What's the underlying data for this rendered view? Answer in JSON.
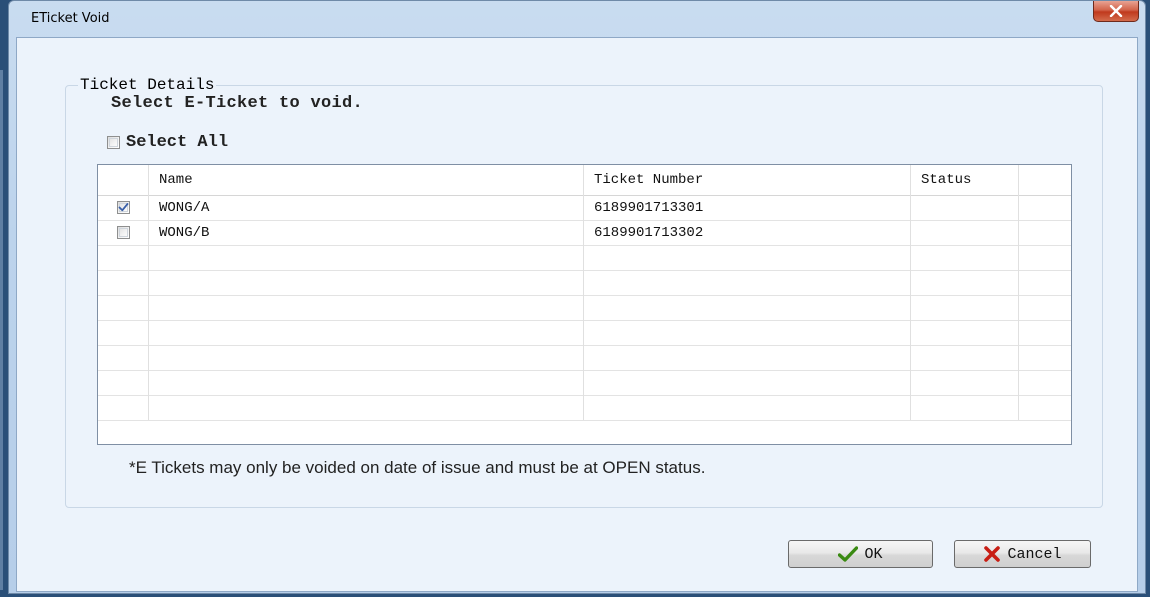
{
  "window": {
    "title": "ETicket Void",
    "close_icon": "close-x-icon"
  },
  "group": {
    "legend": "Ticket Details",
    "instruction": "Select E-Ticket to void.",
    "select_all_label": "Select All",
    "select_all_checked": false
  },
  "table": {
    "columns": [
      "",
      "Name",
      "Ticket Number",
      "Status",
      ""
    ],
    "rows": [
      {
        "checked": true,
        "name": "WONG/A",
        "ticket_number": "6189901713301",
        "status": ""
      },
      {
        "checked": false,
        "name": "WONG/B",
        "ticket_number": "6189901713302",
        "status": ""
      }
    ],
    "empty_row_count": 7
  },
  "note": "*E Tickets may only be voided on date of issue and must be at OPEN status.",
  "buttons": {
    "ok_label": "OK",
    "ok_icon": "checkmark-icon",
    "cancel_label": "Cancel",
    "cancel_icon": "red-x-icon"
  },
  "colors": {
    "ok_check": "#3a8a12",
    "cancel_x": "#c81e14",
    "checkbox_tick": "#3a5fa8"
  }
}
